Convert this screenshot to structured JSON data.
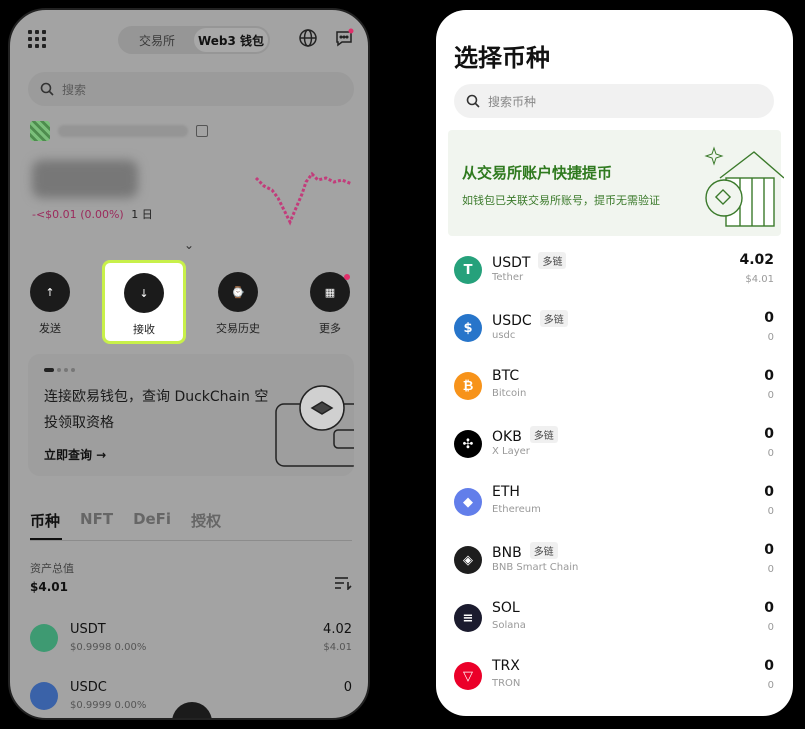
{
  "left_screen": {
    "header": {
      "tabs": [
        "交易所",
        "Web3 钱包"
      ],
      "active_tab": "Web3 钱包",
      "icons": [
        "apps-grid-icon",
        "globe-icon",
        "message-icon"
      ]
    },
    "search": {
      "placeholder": "搜索"
    },
    "account": {
      "balance_change": "-<$0.01",
      "percent": "(0.00%)",
      "period": "1 日"
    },
    "actions": [
      {
        "label": "发送",
        "icon": "arrow-up-icon"
      },
      {
        "label": "接收",
        "icon": "arrow-down-icon"
      },
      {
        "label": "交易历史",
        "icon": "history-icon"
      },
      {
        "label": "更多",
        "icon": "grid-more-icon"
      }
    ],
    "banner": {
      "text": "连接欧易钱包，查询 DuckChain 空投领取资格",
      "cta": "立即查询 →"
    },
    "asset_tabs": [
      "币种",
      "NFT",
      "DeFi",
      "授权"
    ],
    "active_asset_tab": "币种",
    "total": {
      "label": "资产总值",
      "value": "$4.01"
    },
    "tokens": [
      {
        "symbol": "USDT",
        "price": "$0.9998",
        "change": "0.00%",
        "amount": "4.02",
        "value": "$4.01",
        "color": "#3e9a72"
      },
      {
        "symbol": "USDC",
        "price": "$0.9999",
        "change": "0.00%",
        "amount": "0",
        "value": "",
        "color": "#3a62a8"
      }
    ]
  },
  "right_screen": {
    "title": "选择币种",
    "search": {
      "placeholder": "搜索币种"
    },
    "promo": {
      "title": "从交易所账户快捷提币",
      "subtitle": "如钱包已关联交易所账号，提币无需验证"
    },
    "tokens": [
      {
        "symbol": "USDT",
        "name": "Tether",
        "badge": "多链",
        "amount": "4.02",
        "value": "$4.01",
        "color": "#26a17b",
        "glyph": "T"
      },
      {
        "symbol": "USDC",
        "name": "usdc",
        "badge": "多链",
        "amount": "0",
        "value": "0",
        "color": "#2775ca",
        "glyph": "$"
      },
      {
        "symbol": "BTC",
        "name": "Bitcoin",
        "badge": "",
        "amount": "0",
        "value": "0",
        "color": "#f7931a",
        "glyph": "₿"
      },
      {
        "symbol": "OKB",
        "name": "X Layer",
        "badge": "多链",
        "amount": "0",
        "value": "0",
        "color": "#000000",
        "glyph": "✣"
      },
      {
        "symbol": "ETH",
        "name": "Ethereum",
        "badge": "",
        "amount": "0",
        "value": "0",
        "color": "#627eea",
        "glyph": "◆"
      },
      {
        "symbol": "BNB",
        "name": "BNB Smart Chain",
        "badge": "多链",
        "amount": "0",
        "value": "0",
        "color": "#1e1e1e",
        "glyph": "◈"
      },
      {
        "symbol": "SOL",
        "name": "Solana",
        "badge": "",
        "amount": "0",
        "value": "0",
        "color": "#1b1b2e",
        "glyph": "≡"
      },
      {
        "symbol": "TRX",
        "name": "TRON",
        "badge": "",
        "amount": "0",
        "value": "0",
        "color": "#eb0029",
        "glyph": "▽"
      }
    ]
  }
}
